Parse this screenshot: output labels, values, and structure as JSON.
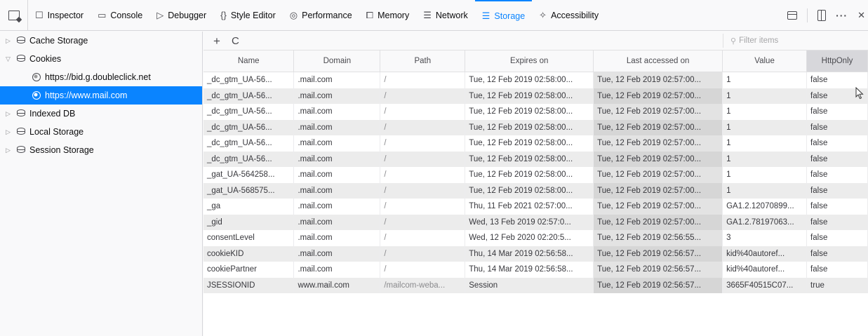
{
  "toolbar": {
    "tabs": [
      {
        "label": "Inspector",
        "icon": "inspector-icon",
        "glyph": "☐"
      },
      {
        "label": "Console",
        "icon": "console-icon",
        "glyph": "▭"
      },
      {
        "label": "Debugger",
        "icon": "debugger-icon",
        "glyph": "▷"
      },
      {
        "label": "Style Editor",
        "icon": "style-editor-icon",
        "glyph": "{}"
      },
      {
        "label": "Performance",
        "icon": "performance-icon",
        "glyph": "◎"
      },
      {
        "label": "Memory",
        "icon": "memory-icon",
        "glyph": "⧠"
      },
      {
        "label": "Network",
        "icon": "network-icon",
        "glyph": "☰"
      },
      {
        "label": "Storage",
        "icon": "storage-icon",
        "glyph": "☰"
      },
      {
        "label": "Accessibility",
        "icon": "accessibility-icon",
        "glyph": "✧"
      }
    ],
    "active_tab": "Storage",
    "more": "···",
    "close": "✕"
  },
  "sidebar": {
    "items": [
      {
        "label": "Cache Storage",
        "twisty": "▷"
      },
      {
        "label": "Cookies",
        "twisty": "▽"
      },
      {
        "label": "https://bid.g.doubleclick.net"
      },
      {
        "label": "https://www.mail.com"
      },
      {
        "label": "Indexed DB",
        "twisty": "▷"
      },
      {
        "label": "Local Storage",
        "twisty": "▷"
      },
      {
        "label": "Session Storage",
        "twisty": "▷"
      }
    ]
  },
  "actions": {
    "add": "+",
    "refresh": "C"
  },
  "filter": {
    "placeholder": "Filter items"
  },
  "table": {
    "columns": [
      "Name",
      "Domain",
      "Path",
      "Expires on",
      "Last accessed on",
      "Value",
      "HttpOnly"
    ],
    "sorted_column": "HttpOnly",
    "rows": [
      [
        "_dc_gtm_UA-56...",
        ".mail.com",
        "/",
        "Tue, 12 Feb 2019 02:58:00...",
        "Tue, 12 Feb 2019 02:57:00...",
        "1",
        "false"
      ],
      [
        "_dc_gtm_UA-56...",
        ".mail.com",
        "/",
        "Tue, 12 Feb 2019 02:58:00...",
        "Tue, 12 Feb 2019 02:57:00...",
        "1",
        "false"
      ],
      [
        "_dc_gtm_UA-56...",
        ".mail.com",
        "/",
        "Tue, 12 Feb 2019 02:58:00...",
        "Tue, 12 Feb 2019 02:57:00...",
        "1",
        "false"
      ],
      [
        "_dc_gtm_UA-56...",
        ".mail.com",
        "/",
        "Tue, 12 Feb 2019 02:58:00...",
        "Tue, 12 Feb 2019 02:57:00...",
        "1",
        "false"
      ],
      [
        "_dc_gtm_UA-56...",
        ".mail.com",
        "/",
        "Tue, 12 Feb 2019 02:58:00...",
        "Tue, 12 Feb 2019 02:57:00...",
        "1",
        "false"
      ],
      [
        "_dc_gtm_UA-56...",
        ".mail.com",
        "/",
        "Tue, 12 Feb 2019 02:58:00...",
        "Tue, 12 Feb 2019 02:57:00...",
        "1",
        "false"
      ],
      [
        "_gat_UA-564258...",
        ".mail.com",
        "/",
        "Tue, 12 Feb 2019 02:58:00...",
        "Tue, 12 Feb 2019 02:57:00...",
        "1",
        "false"
      ],
      [
        "_gat_UA-568575...",
        ".mail.com",
        "/",
        "Tue, 12 Feb 2019 02:58:00...",
        "Tue, 12 Feb 2019 02:57:00...",
        "1",
        "false"
      ],
      [
        "_ga",
        ".mail.com",
        "/",
        "Thu, 11 Feb 2021 02:57:00...",
        "Tue, 12 Feb 2019 02:57:00...",
        "GA1.2.12070899...",
        "false"
      ],
      [
        "_gid",
        ".mail.com",
        "/",
        "Wed, 13 Feb 2019 02:57:0...",
        "Tue, 12 Feb 2019 02:57:00...",
        "GA1.2.78197063...",
        "false"
      ],
      [
        "consentLevel",
        ".mail.com",
        "/",
        "Wed, 12 Feb 2020 02:20:5...",
        "Tue, 12 Feb 2019 02:56:55...",
        "3",
        "false"
      ],
      [
        "cookieKID",
        ".mail.com",
        "/",
        "Thu, 14 Mar 2019 02:56:58...",
        "Tue, 12 Feb 2019 02:56:57...",
        "kid%40autoref...",
        "false"
      ],
      [
        "cookiePartner",
        ".mail.com",
        "/",
        "Thu, 14 Mar 2019 02:56:58...",
        "Tue, 12 Feb 2019 02:56:57...",
        "kid%40autoref...",
        "false"
      ],
      [
        "JSESSIONID",
        "www.mail.com",
        "/mailcom-weba...",
        "Session",
        "Tue, 12 Feb 2019 02:56:57...",
        "3665F40515C07...",
        "true"
      ]
    ]
  },
  "colors": {
    "accent": "#0a84ff",
    "selection": "#0a84ff"
  }
}
